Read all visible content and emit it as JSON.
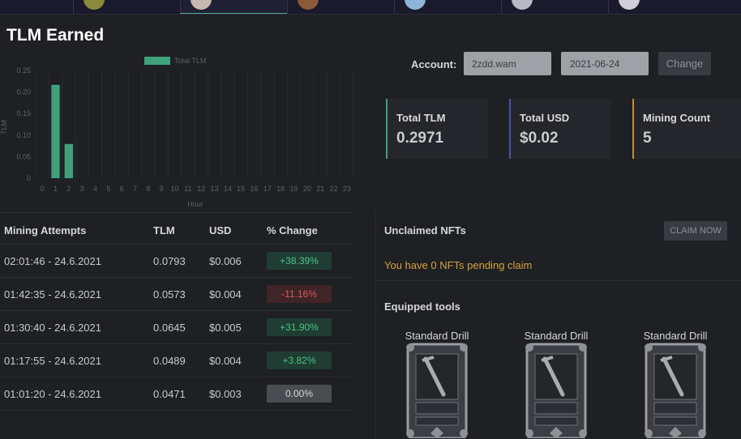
{
  "page": {
    "title": "TLM Earned"
  },
  "chart_data": {
    "type": "bar",
    "legend": "Total TLM",
    "legend_placement": "top-center",
    "color": "#3fa27b",
    "ylabel": "TLM",
    "xlabel": "Hour",
    "ylim": [
      0,
      0.25
    ],
    "yticks": [
      "0",
      "0.05",
      "0.10",
      "0.15",
      "0.20",
      "0.25"
    ],
    "categories": [
      "0",
      "1",
      "2",
      "3",
      "4",
      "5",
      "6",
      "7",
      "8",
      "9",
      "10",
      "11",
      "12",
      "13",
      "14",
      "15",
      "16",
      "17",
      "18",
      "19",
      "20",
      "21",
      "22",
      "23"
    ],
    "values": [
      0,
      0.2166,
      0.0793,
      0,
      0,
      0,
      0,
      0,
      0,
      0,
      0,
      0,
      0,
      0,
      0,
      0,
      0,
      0,
      0,
      0,
      0,
      0,
      0,
      0
    ],
    "grid": true
  },
  "account": {
    "label": "Account:",
    "value": "2zdd.wam",
    "date": "2021-06-24",
    "change_label": "Change"
  },
  "stats": [
    {
      "label": "Total TLM",
      "value": "0.2971",
      "accent": "#3fa27b"
    },
    {
      "label": "Total USD",
      "value": "$0.02",
      "accent": "#4b4fb0"
    },
    {
      "label": "Mining Count",
      "value": "5",
      "accent": "#c48a3a"
    }
  ],
  "table": {
    "headers": [
      "Mining Attempts",
      "TLM",
      "USD",
      "% Change"
    ],
    "rows": [
      {
        "time": "02:01:46 - 24.6.2021",
        "tlm": "0.0793",
        "usd": "$0.006",
        "change": "+38.39%",
        "trend": "pos"
      },
      {
        "time": "01:42:35 - 24.6.2021",
        "tlm": "0.0573",
        "usd": "$0.004",
        "change": "-11.16%",
        "trend": "neg"
      },
      {
        "time": "01:30:40 - 24.6.2021",
        "tlm": "0.0645",
        "usd": "$0.005",
        "change": "+31.90%",
        "trend": "pos"
      },
      {
        "time": "01:17:55 - 24.6.2021",
        "tlm": "0.0489",
        "usd": "$0.004",
        "change": "+3.82%",
        "trend": "pos"
      },
      {
        "time": "01:01:20 - 24.6.2021",
        "tlm": "0.0471",
        "usd": "$0.003",
        "change": "0.00%",
        "trend": "zero"
      }
    ]
  },
  "nfts": {
    "title": "Unclaimed NFTs",
    "claim_label": "CLAIM NOW",
    "message": "You have 0 NFTs pending claim"
  },
  "tools": {
    "title": "Equipped tools",
    "items": [
      {
        "name": "Standard Drill"
      },
      {
        "name": "Standard Drill"
      },
      {
        "name": "Standard Drill"
      }
    ]
  }
}
